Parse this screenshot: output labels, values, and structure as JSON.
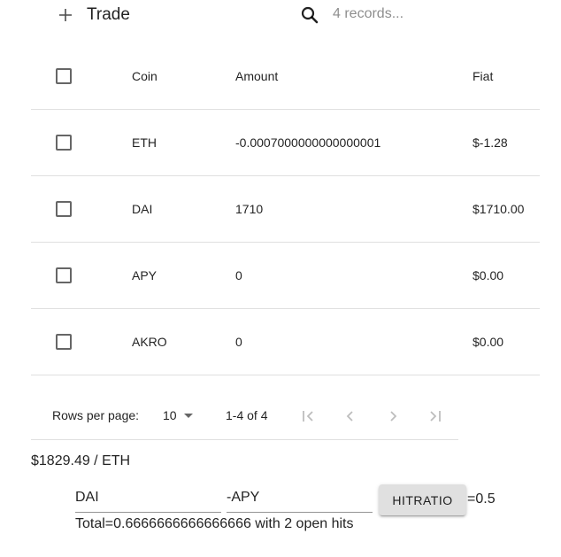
{
  "toolbar": {
    "add_label": "Trade",
    "search_placeholder": "4 records..."
  },
  "table": {
    "columns": [
      "Coin",
      "Amount",
      "Fiat"
    ],
    "rows": [
      {
        "coin": "ETH",
        "amount": "-0.0007000000000000001",
        "fiat": "$-1.28"
      },
      {
        "coin": "DAI",
        "amount": "1710",
        "fiat": "$1710.00"
      },
      {
        "coin": "APY",
        "amount": "0",
        "fiat": "$0.00"
      },
      {
        "coin": "AKRO",
        "amount": "0",
        "fiat": "$0.00"
      }
    ]
  },
  "pagination": {
    "rows_per_page_label": "Rows per page:",
    "rows_per_page_value": "10",
    "range": "1-4 of 4"
  },
  "price_line": "$1829.49 / ETH",
  "hit_form": {
    "first_value": "DAI",
    "second_value": "-APY",
    "button_label": "HITRATIO",
    "ratio_text": "=0.5",
    "total_text": "Total=0.6666666666666666 with 2 open hits"
  }
}
